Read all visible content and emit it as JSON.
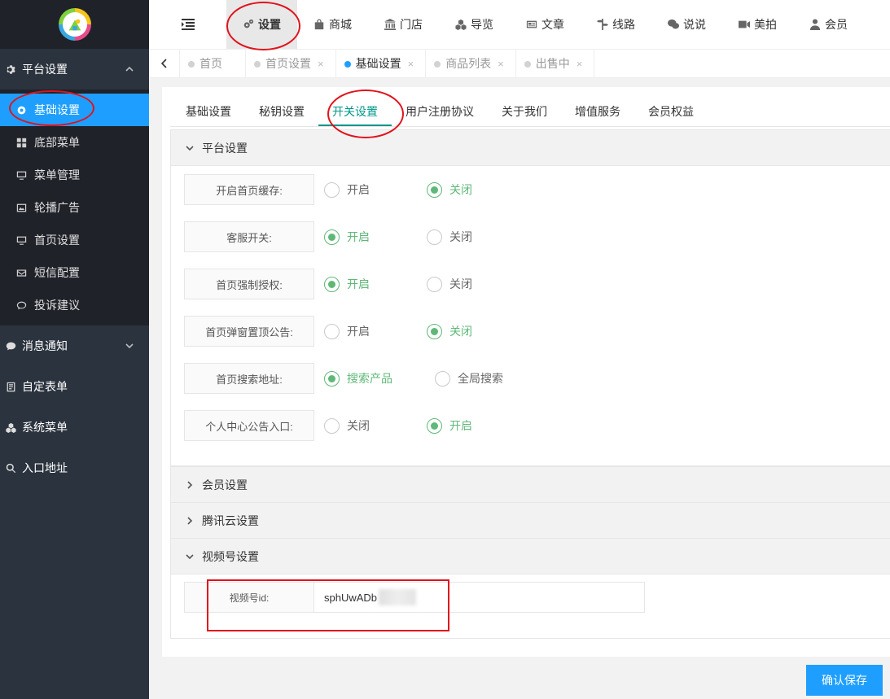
{
  "sidebar": {
    "groups": [
      {
        "label": "平台设置",
        "icon": "gear-icon",
        "expanded": true
      },
      {
        "label": "消息通知",
        "icon": "chat-icon",
        "expanded": false
      },
      {
        "label": "自定表单",
        "icon": "form-icon"
      },
      {
        "label": "系统菜单",
        "icon": "cubes-icon"
      },
      {
        "label": "入口地址",
        "icon": "search-icon"
      }
    ],
    "items": [
      {
        "label": "基础设置",
        "icon": "gear-icon",
        "active": true
      },
      {
        "label": "底部菜单",
        "icon": "grid-icon"
      },
      {
        "label": "菜单管理",
        "icon": "monitor-icon"
      },
      {
        "label": "轮播广告",
        "icon": "image-icon"
      },
      {
        "label": "首页设置",
        "icon": "monitor-icon"
      },
      {
        "label": "短信配置",
        "icon": "mail-icon"
      },
      {
        "label": "投诉建议",
        "icon": "comment-icon"
      }
    ]
  },
  "topnav": [
    {
      "label": "设置",
      "icon": "gears-icon",
      "active": true
    },
    {
      "label": "商城",
      "icon": "shop-icon"
    },
    {
      "label": "门店",
      "icon": "bank-icon"
    },
    {
      "label": "导览",
      "icon": "cubes-icon"
    },
    {
      "label": "文章",
      "icon": "newspaper-icon"
    },
    {
      "label": "线路",
      "icon": "route-icon"
    },
    {
      "label": "说说",
      "icon": "wechat-icon"
    },
    {
      "label": "美拍",
      "icon": "video-icon"
    },
    {
      "label": "会员",
      "icon": "user-icon"
    }
  ],
  "page_tabs": [
    {
      "label": "首页",
      "closable": false
    },
    {
      "label": "首页设置",
      "closable": true
    },
    {
      "label": "基础设置",
      "closable": true,
      "active": true
    },
    {
      "label": "商品列表",
      "closable": true
    },
    {
      "label": "出售中",
      "closable": true
    }
  ],
  "close_glyph": "×",
  "sub_tabs": [
    "基础设置",
    "秘钥设置",
    "开关设置",
    "用户注册协议",
    "关于我们",
    "增值服务",
    "会员权益"
  ],
  "sub_tabs_active": 2,
  "panels": {
    "platform": "平台设置",
    "member": "会员设置",
    "tencent": "腾讯云设置",
    "video": "视频号设置"
  },
  "switches": [
    {
      "label": "开启首页缓存:",
      "opt1": "开启",
      "opt2": "关闭",
      "checked": 2
    },
    {
      "label": "客服开关:",
      "opt1": "开启",
      "opt2": "关闭",
      "checked": 1
    },
    {
      "label": "首页强制授权:",
      "opt1": "开启",
      "opt2": "关闭",
      "checked": 1
    },
    {
      "label": "首页弹窗置顶公告:",
      "opt1": "开启",
      "opt2": "关闭",
      "checked": 2
    },
    {
      "label": "首页搜索地址:",
      "opt1": "搜索产品",
      "opt2": "全局搜索",
      "checked": 1
    },
    {
      "label": "个人中心公告入口:",
      "opt1": "关闭",
      "opt2": "开启",
      "checked": 2
    }
  ],
  "video": {
    "label": "视频号id:",
    "value": "sphUwADb"
  },
  "save_label": "确认保存",
  "colors": {
    "accent": "#1e9fff",
    "checked": "#5FB878",
    "tab_active": "#009688",
    "annotation": "#e0131c"
  }
}
